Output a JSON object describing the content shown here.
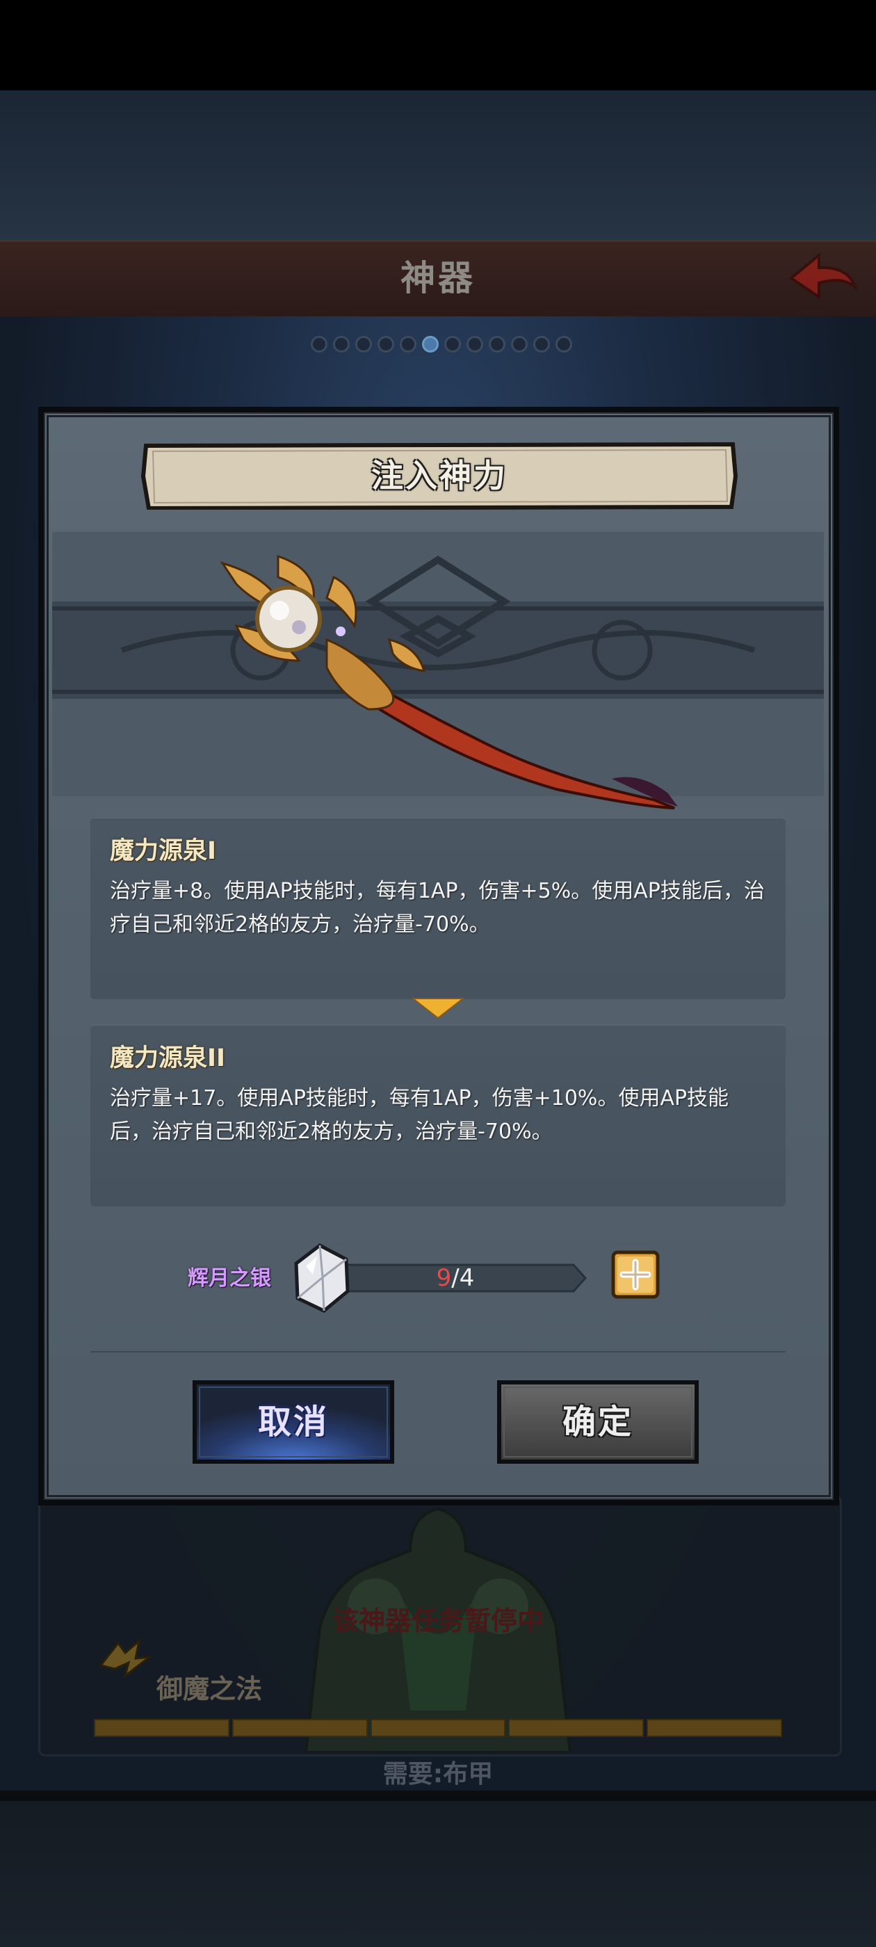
{
  "background": {
    "title": "神器",
    "paused_text": "该神器任务暂停中",
    "skill_name": "御魔之法",
    "requirement": "需要:布甲"
  },
  "dialog": {
    "title": "注入神力",
    "current": {
      "name": "魔力源泉I",
      "description": "治疗量+8。使用AP技能时，每有1AP，伤害+5%。使用AP技能后，治疗自己和邻近2格的友方，治疗量-70%。"
    },
    "next": {
      "name": "魔力源泉II",
      "description": "治疗量+17。使用AP技能时，每有1AP，伤害+10%。使用AP技能后，治疗自己和邻近2格的友方，治疗量-70%。"
    },
    "material": {
      "name": "辉月之银",
      "owned": "9",
      "separator": "/",
      "required": "4"
    },
    "cancel_label": "取消",
    "confirm_label": "确定"
  },
  "icons": [
    "back-arrow-icon",
    "staff-artifact-icon",
    "moonsilver-gem-icon",
    "plus-icon",
    "chevron-down-icon",
    "skill-emblem-icon"
  ],
  "colors": {
    "material_label": "#d59cff",
    "count_insufficient": "#e44c4c",
    "title_gold": "#f2e8c4",
    "back_arrow": "#c0281e"
  }
}
